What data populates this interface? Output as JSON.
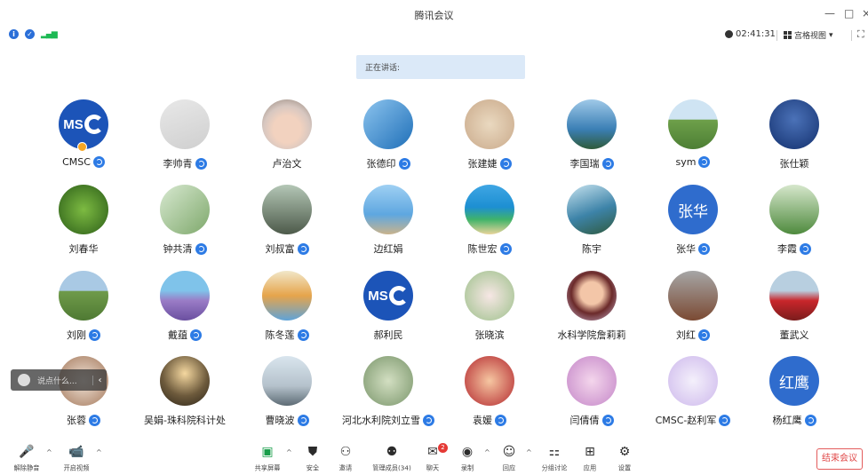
{
  "app": {
    "title": "腾讯会议"
  },
  "window_controls": {
    "minimize": "—",
    "maximize": "□",
    "close": "×"
  },
  "status": {
    "timer": "02:41:31",
    "view_label": "宫格视图",
    "view_caret": "▾",
    "fullscreen": "⛶"
  },
  "speaking": {
    "label": "正在讲话:"
  },
  "colors": {
    "accent": "#2d7be5",
    "speaking_bg": "#dbe9f8",
    "end_red": "#e04848",
    "badge_red": "#e53935"
  },
  "participants": [
    {
      "name": "CMSC",
      "badge": true,
      "avatar": "logo",
      "host": true
    },
    {
      "name": "李帅青",
      "badge": true,
      "avatar": "photo",
      "bg": "linear-gradient(160deg,#e8e8e8,#cfcfcf)"
    },
    {
      "name": "卢治文",
      "badge": false,
      "avatar": "photo",
      "bg": "radial-gradient(circle at 50% 60%,#f2d2bf 35%,#d7c7c0 60%,#8a7d72)"
    },
    {
      "name": "张德印",
      "badge": true,
      "avatar": "photo",
      "bg": "linear-gradient(135deg,#8cc4ee,#1f6fb8)"
    },
    {
      "name": "张建婕",
      "badge": true,
      "avatar": "photo",
      "bg": "radial-gradient(circle,#ead9c0,#c9a98a)"
    },
    {
      "name": "李国瑞",
      "badge": true,
      "avatar": "photo",
      "bg": "linear-gradient(180deg,#9fc9e8,#3b7fb5 60%,#2f5b3a)"
    },
    {
      "name": "sym",
      "badge": true,
      "avatar": "photo",
      "bg": "linear-gradient(180deg,#cfe4f3 40%,#6ea04a 41%,#4d7f34)"
    },
    {
      "name": "张仕颖",
      "badge": false,
      "avatar": "photo",
      "bg": "radial-gradient(circle at 50% 40%,#4b72b8,#13306e)"
    },
    {
      "name": "刘春华",
      "badge": false,
      "avatar": "photo",
      "bg": "radial-gradient(circle,#7dbb42,#2b5d18)"
    },
    {
      "name": "钟共清",
      "badge": true,
      "avatar": "photo",
      "bg": "linear-gradient(135deg,#d8e9d1,#7ea86b)"
    },
    {
      "name": "刘叔富",
      "badge": true,
      "avatar": "photo",
      "bg": "linear-gradient(180deg,#b4c7b6,#4d5a4a)"
    },
    {
      "name": "边红娟",
      "badge": false,
      "avatar": "photo",
      "bg": "linear-gradient(180deg,#9fd0f3,#5ea7e0 60%,#c9b38c)"
    },
    {
      "name": "陈世宏",
      "badge": true,
      "avatar": "photo",
      "bg": "linear-gradient(180deg,#3fa6e4,#1d8fd2 45%,#40b36a 70%,#e9d49a)"
    },
    {
      "name": "陈宇",
      "badge": false,
      "avatar": "photo",
      "bg": "linear-gradient(160deg,#c7e3ef,#3d83a8 55%,#2f5a3e)"
    },
    {
      "name": "张华",
      "badge": true,
      "avatar": "text",
      "text": "张华",
      "bg": "#2f6ccd"
    },
    {
      "name": "李霞",
      "badge": true,
      "avatar": "photo",
      "bg": "linear-gradient(180deg,#d6e7cc,#4e8a3d)"
    },
    {
      "name": "刘刚",
      "badge": true,
      "avatar": "photo",
      "bg": "linear-gradient(180deg,#a9c9e4 40%,#6f9b4a 41%,#4f7a33)"
    },
    {
      "name": "戴蕴",
      "badge": true,
      "avatar": "photo",
      "bg": "linear-gradient(180deg,#7fc3ea 40%,#9a7cc6 60%,#6a4fa0)"
    },
    {
      "name": "陈冬莲",
      "badge": true,
      "avatar": "photo",
      "bg": "linear-gradient(180deg,#f1e7c9,#e6a44b 50%,#5fa3d8)"
    },
    {
      "name": "郝利民",
      "badge": false,
      "avatar": "logo"
    },
    {
      "name": "张晓滨",
      "badge": false,
      "avatar": "photo",
      "bg": "radial-gradient(circle,#f7e7e5,#9cc08a)"
    },
    {
      "name": "水科学院詹莉莉",
      "badge": false,
      "avatar": "photo",
      "bg": "radial-gradient(circle at 50% 45%,#f3c6a8 30%,#6b2a2a 55%,#c9b6d6)"
    },
    {
      "name": "刘红",
      "badge": true,
      "avatar": "photo",
      "bg": "linear-gradient(180deg,#a6a6a6,#7b4a33)"
    },
    {
      "name": "董武义",
      "badge": false,
      "avatar": "photo",
      "bg": "linear-gradient(180deg,#b8cfe0 40%,#c9262b 60%,#7a1c1c)"
    },
    {
      "name": "张蓉",
      "badge": true,
      "avatar": "photo",
      "bg": "radial-gradient(circle,#efe2d6,#a4785b)"
    },
    {
      "name": "吴娟-珠科院科计处",
      "badge": false,
      "avatar": "photo",
      "bg": "radial-gradient(circle at 50% 35%,#f5d8a0,#6d5a3c 55%,#2c2418)"
    },
    {
      "name": "曹晓波",
      "badge": true,
      "avatar": "photo",
      "bg": "linear-gradient(180deg,#d9e5ee,#b5c2cc 60%,#5d6b74)"
    },
    {
      "name": "河北水利院刘立雪",
      "badge": true,
      "avatar": "photo",
      "bg": "radial-gradient(circle,#d3dfc2,#79956a)"
    },
    {
      "name": "袁媛",
      "badge": true,
      "avatar": "photo",
      "bg": "radial-gradient(circle,#f6c7a2,#b3262d)"
    },
    {
      "name": "闫倩倩",
      "badge": true,
      "avatar": "photo",
      "bg": "radial-gradient(circle,#f4d6ec,#c486c8)"
    },
    {
      "name": "CMSC-赵利军",
      "badge": true,
      "avatar": "photo",
      "bg": "radial-gradient(circle,#f4f0fb,#cdb8ec)"
    },
    {
      "name": "杨红鹰",
      "badge": true,
      "avatar": "text",
      "text": "红鹰",
      "bg": "#2f6ccd"
    }
  ],
  "chat_popup": {
    "placeholder": "说点什么...",
    "collapse_icon": "‹"
  },
  "toolbar": {
    "left": [
      {
        "id": "unmute",
        "label": "解除静音",
        "glyph": "🎤"
      },
      {
        "id": "video",
        "label": "开启视频",
        "glyph": "📹"
      }
    ],
    "center": [
      {
        "id": "share",
        "label": "共享屏幕",
        "glyph": "▣"
      },
      {
        "id": "security",
        "label": "安全",
        "glyph": "⛊"
      },
      {
        "id": "invite",
        "label": "邀请",
        "glyph": "⚇"
      },
      {
        "id": "members",
        "label": "管理成员(34)",
        "glyph": "⚉"
      },
      {
        "id": "chat",
        "label": "聊天",
        "glyph": "✉",
        "badge": "2"
      },
      {
        "id": "record",
        "label": "录制",
        "glyph": "◉"
      },
      {
        "id": "replay",
        "label": "回应",
        "glyph": "☺"
      },
      {
        "id": "breakout",
        "label": "分组讨论",
        "glyph": "⚏"
      },
      {
        "id": "apps",
        "label": "应用",
        "glyph": "⊞"
      },
      {
        "id": "settings",
        "label": "设置",
        "glyph": "⚙"
      }
    ],
    "caret": "^",
    "end_label": "结束会议"
  }
}
